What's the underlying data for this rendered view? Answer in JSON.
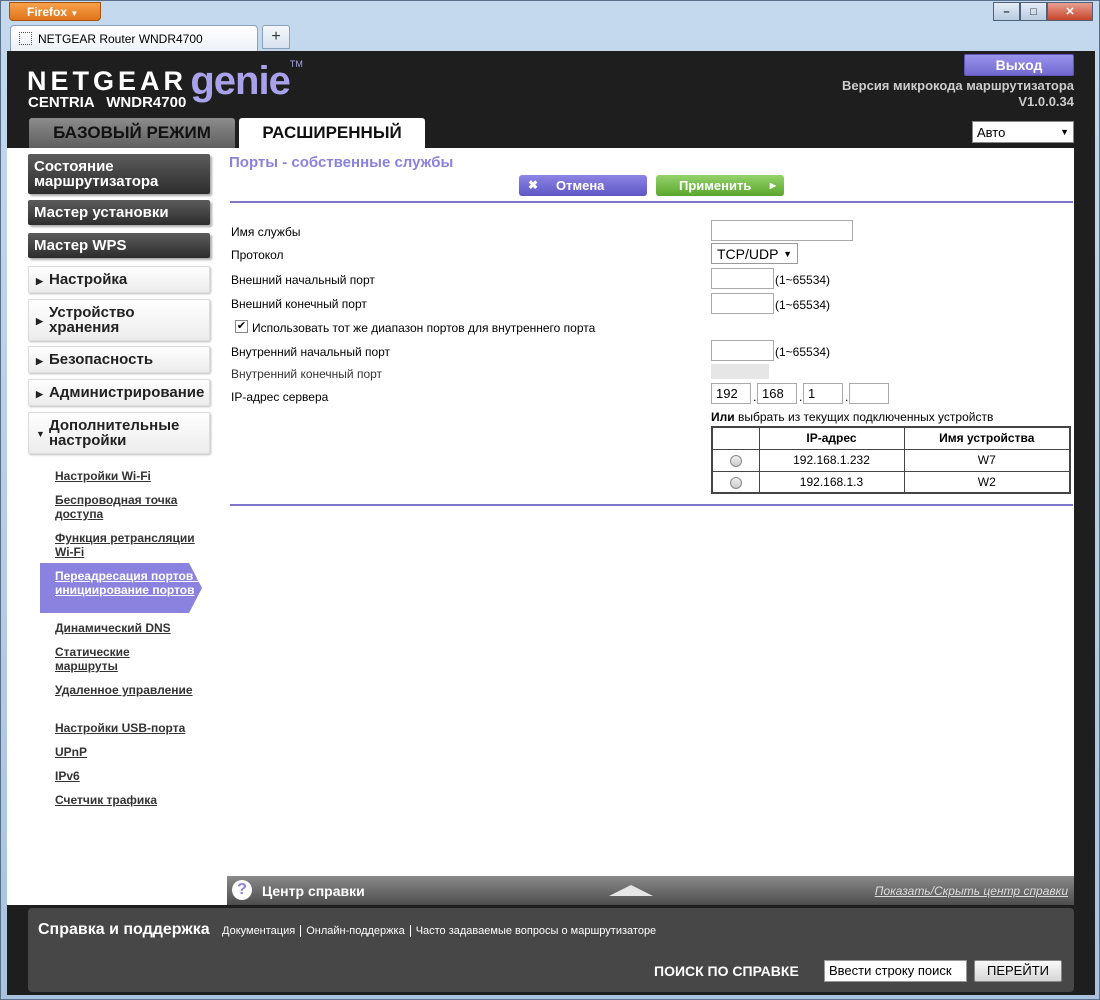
{
  "browser": {
    "menu_label": "Firefox",
    "tab_title": "NETGEAR Router WNDR4700",
    "new_tab": "+",
    "win_min": "–",
    "win_max": "□",
    "win_close": "✕"
  },
  "header": {
    "brand": "NETGEAR",
    "product": "genie",
    "trademark": "TM",
    "model_line": "CENTRIA WNDR4700",
    "logout": "Выход",
    "firmware_label": "Версия микрокода маршрутизатора",
    "firmware_version": "V1.0.0.34",
    "tabs": [
      {
        "label": "БАЗОВЫЙ РЕЖИМ",
        "active": false
      },
      {
        "label": "РАСШИРЕННЫЙ",
        "active": true
      }
    ],
    "language": "Авто"
  },
  "sidebar": {
    "buttons": [
      {
        "label": "Состояние маршрутизатора"
      },
      {
        "label": "Мастер установки"
      },
      {
        "label": "Мастер WPS"
      }
    ],
    "sections": [
      {
        "label": "Настройка",
        "expanded": false
      },
      {
        "label": "Устройство хранения",
        "expanded": false
      },
      {
        "label": "Безопасность",
        "expanded": false
      },
      {
        "label": "Администрирование",
        "expanded": false
      },
      {
        "label": "Дополнительные настройки",
        "expanded": true
      }
    ],
    "links": [
      "Настройки Wi-Fi",
      "Беспроводная точка доступа",
      "Функция ретрансляции Wi-Fi",
      "Переадресация портов / инициирование портов",
      "Динамический DNS",
      "Статические маршруты",
      "Удаленное управление",
      "Настройки USB-порта",
      "UPnP",
      "IPv6",
      "Счетчик трафика"
    ],
    "active_link_index": 3
  },
  "main": {
    "title": "Порты - собственные службы",
    "cancel": "Отмена",
    "apply": "Применить",
    "fields": {
      "service_name_label": "Имя службы",
      "service_name_value": "",
      "protocol_label": "Протокол",
      "protocol_value": "TCP/UDP",
      "ext_start_label": "Внешний начальный порт",
      "ext_start_value": "",
      "ext_end_label": "Внешний конечный порт",
      "ext_end_value": "",
      "range_hint": "(1~65534)",
      "same_range_label": "Использовать тот же диапазон портов для внутреннего порта",
      "same_range_checked": true,
      "int_start_label": "Внутренний начальный порт",
      "int_start_value": "",
      "int_end_label": "Внутренний конечный порт",
      "server_ip_label": "IP-адрес сервера",
      "ip": [
        "192",
        "168",
        "1",
        ""
      ]
    },
    "or_select_bold": "Или",
    "or_select_rest": " выбрать из текущих подключенных устройств",
    "device_table": {
      "headers": [
        "",
        "IP-адрес",
        "Имя устройства"
      ],
      "rows": [
        {
          "ip": "192.168.1.232",
          "name": "W7"
        },
        {
          "ip": "192.168.1.3",
          "name": "W2"
        }
      ]
    }
  },
  "helpbar": {
    "icon": "?",
    "title": "Центр справки",
    "toggle": "Показать/Скрыть центр справки"
  },
  "footer": {
    "title": "Справка и поддержка",
    "links": [
      "Документация",
      "Онлайн-поддержка",
      "Часто задаваемые вопросы о маршрутизаторе"
    ],
    "search_label": "ПОИСК ПО СПРАВКЕ",
    "search_value": "Ввести строку поиск",
    "go": "ПЕРЕЙТИ"
  }
}
